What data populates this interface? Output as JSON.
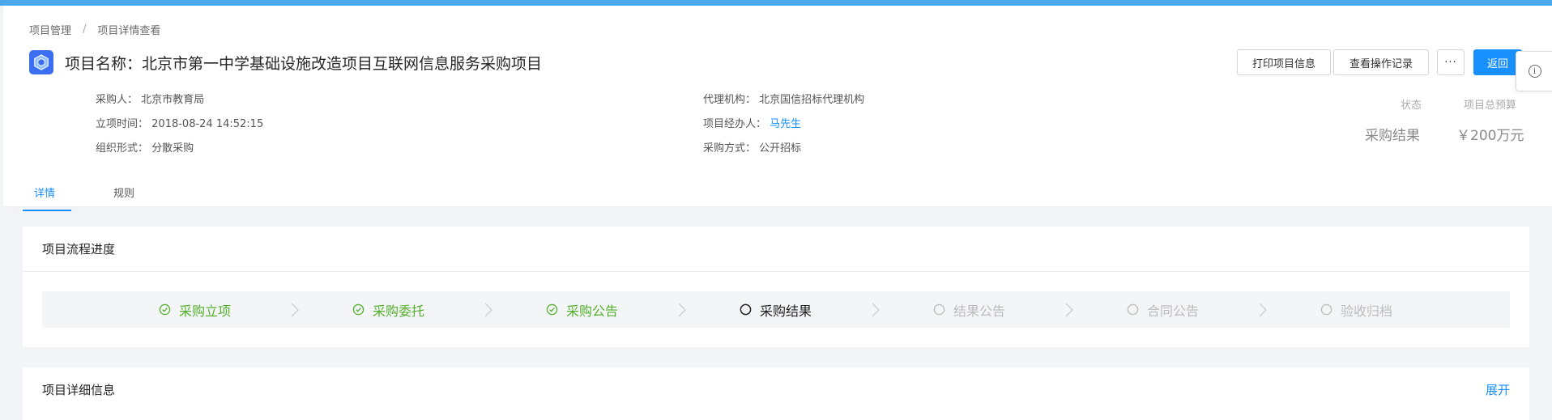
{
  "breadcrumb": [
    "项目管理",
    "项目详情查看"
  ],
  "project": {
    "title_prefix": "项目名称：",
    "title": "北京市第一中学基础设施改造项目互联网信息服务采购项目"
  },
  "actions": {
    "print": "打印项目信息",
    "log": "查看操作记录",
    "more": "···",
    "back": "返回"
  },
  "info_icon": "info-icon",
  "fields": {
    "purchaser": {
      "label": "采购人：",
      "value": "北京市教育局"
    },
    "created": {
      "label": "立项时间：",
      "value": "2018-08-24 14:52:15"
    },
    "org_form": {
      "label": "组织形式：",
      "value": "分散采购"
    },
    "agency": {
      "label": "代理机构：",
      "value": "北京国信招标代理机构"
    },
    "handler": {
      "label": "项目经办人：",
      "value": "马先生"
    },
    "method": {
      "label": "采购方式：",
      "value": "公开招标"
    }
  },
  "stats": {
    "status_label": "状态",
    "status_value": "采购结果",
    "budget_label": "项目总预算",
    "budget_value": "￥200万元"
  },
  "tabs": [
    "详情",
    "规则"
  ],
  "active_tab": "详情",
  "progress": {
    "title": "项目流程进度",
    "steps": [
      {
        "label": "采购立项",
        "state": "done"
      },
      {
        "label": "采购委托",
        "state": "done"
      },
      {
        "label": "采购公告",
        "state": "done"
      },
      {
        "label": "采购结果",
        "state": "current"
      },
      {
        "label": "结果公告",
        "state": "pending"
      },
      {
        "label": "合同公告",
        "state": "pending"
      },
      {
        "label": "验收归档",
        "state": "pending"
      }
    ]
  },
  "detail": {
    "title": "项目详细信息",
    "expand": "展开"
  },
  "colors": {
    "primary": "#1890ff",
    "done": "#52b02c",
    "pending": "#bbbbbb",
    "topbar": "#4aa8ee"
  }
}
